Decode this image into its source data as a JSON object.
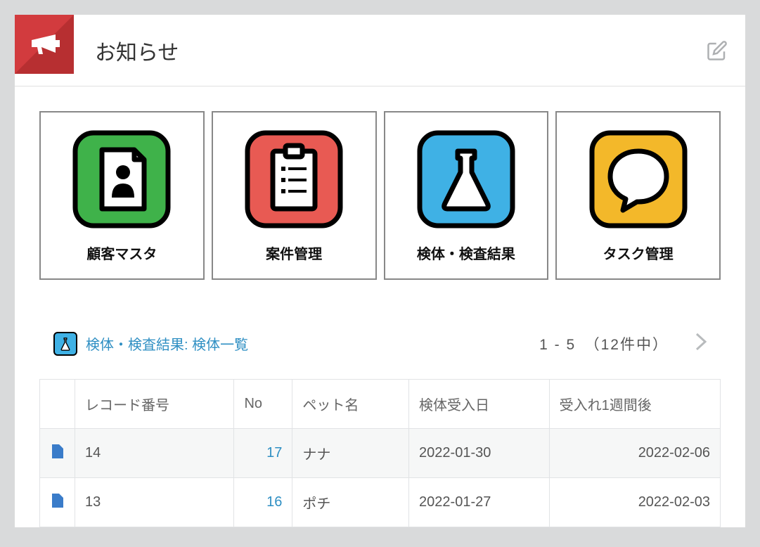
{
  "header": {
    "title": "お知らせ"
  },
  "tiles": [
    {
      "label": "顧客マスタ"
    },
    {
      "label": "案件管理"
    },
    {
      "label": "検体・検査結果"
    },
    {
      "label": "タスク管理"
    }
  ],
  "list": {
    "title": "検体・検査結果: 検体一覧",
    "pager": "1 - 5　（12件中）",
    "columns": {
      "record_no": "レコード番号",
      "no": "No",
      "pet_name": "ペット名",
      "received_date": "検体受入日",
      "week_after": "受入れ1週間後"
    },
    "rows": [
      {
        "record_no": "14",
        "no": "17",
        "pet_name": "ナナ",
        "received_date": "2022-01-30",
        "week_after": "2022-02-06"
      },
      {
        "record_no": "13",
        "no": "16",
        "pet_name": "ポチ",
        "received_date": "2022-01-27",
        "week_after": "2022-02-03"
      }
    ]
  }
}
